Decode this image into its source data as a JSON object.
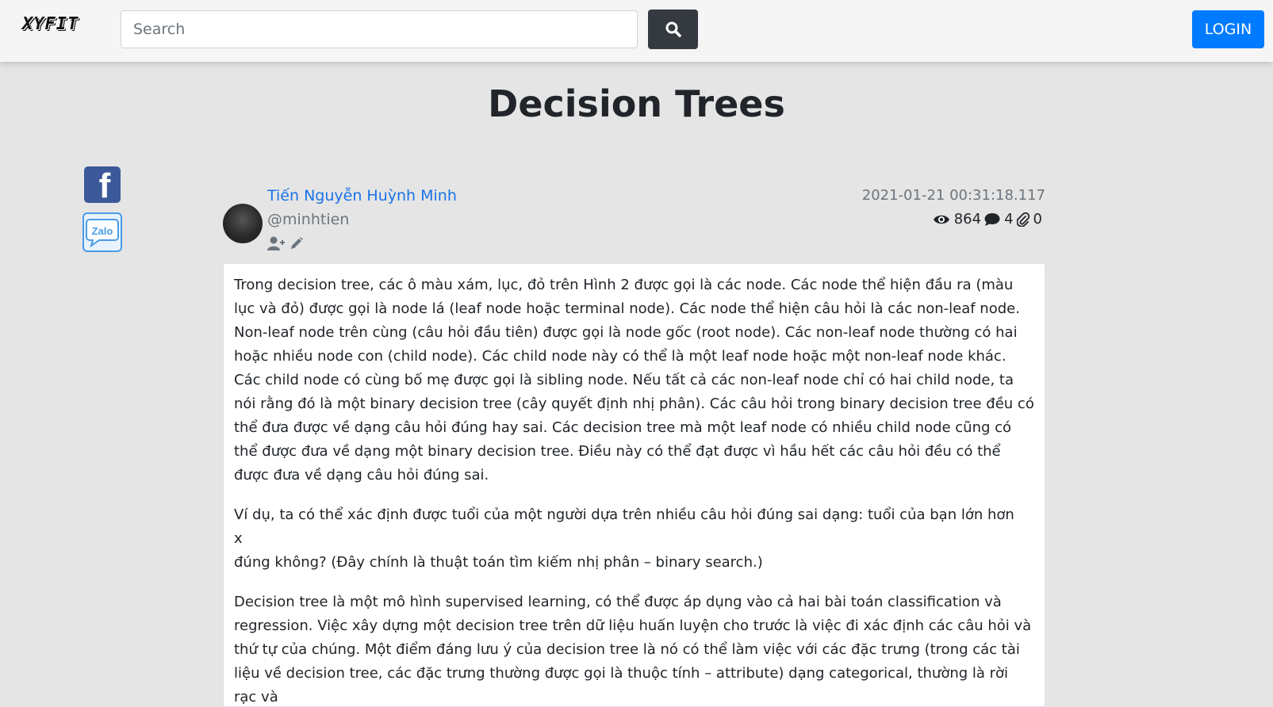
{
  "header": {
    "logo": "XYFIT",
    "search_placeholder": "Search",
    "search_icon": "search-icon",
    "login_label": "LOGIN"
  },
  "page": {
    "title": "Decision Trees"
  },
  "share": {
    "facebook_label": "f",
    "zalo_label": "Zalo"
  },
  "author": {
    "name": "Tiến Nguyễn Huỳnh Minh",
    "handle": "@minhtien",
    "actions": [
      "user-plus-icon",
      "pencil-icon"
    ]
  },
  "post": {
    "date": "2021-01-21 00:31:18.117",
    "views": "864",
    "comments": "4",
    "attachments": "0"
  },
  "content": {
    "p1": "Trong decision tree, các ô màu xám, lục, đỏ trên Hình 2 được gọi là các node. Các node thể hiện đầu ra (màu lục và đỏ) được gọi là node lá (leaf node hoặc terminal node). Các node thể hiện câu hỏi là các non-leaf node. Non-leaf node trên cùng (câu hỏi đầu tiên) được gọi là node gốc (root node). Các non-leaf node thường có hai hoặc nhiều node con (child node). Các child node này có thể là một leaf node hoặc một non-leaf node khác. Các child node có cùng bố mẹ được gọi là sibling node. Nếu tất cả các non-leaf node chỉ có hai child node, ta nói rằng đó là một binary decision tree (cây quyết định nhị phân). Các câu hỏi trong binary decision tree đều có thể đưa được về dạng câu hỏi đúng hay sai. Các decision tree mà một leaf node có nhiều child node cũng có thể được đưa về dạng một binary decision tree. Điều này có thể đạt được vì hầu hết các câu hỏi đều có thể được đưa về dạng câu hỏi đúng sai.",
    "p2_line1": "Ví dụ, ta có thể xác định được tuổi của một người dựa trên nhiều câu hỏi đúng sai dạng: tuổi của bạn lớn hơn",
    "p2_line2": "x",
    "p2_line3": "đúng không? (Đây chính là thuật toán tìm kiếm nhị phân – binary search.)",
    "p3": "Decision tree là một mô hình supervised learning, có thể được áp dụng vào cả hai bài toán classification và regression. Việc xây dựng một decision tree trên dữ liệu huấn luyện cho trước là việc đi xác định các câu hỏi và thứ tự của chúng. Một điểm đáng lưu ý của decision tree là nó có thể làm việc với các đặc trưng (trong các tài liệu về decision tree, các đặc trưng thường được gọi là thuộc tính – attribute) dạng categorical, thường là rời rạc và"
  }
}
